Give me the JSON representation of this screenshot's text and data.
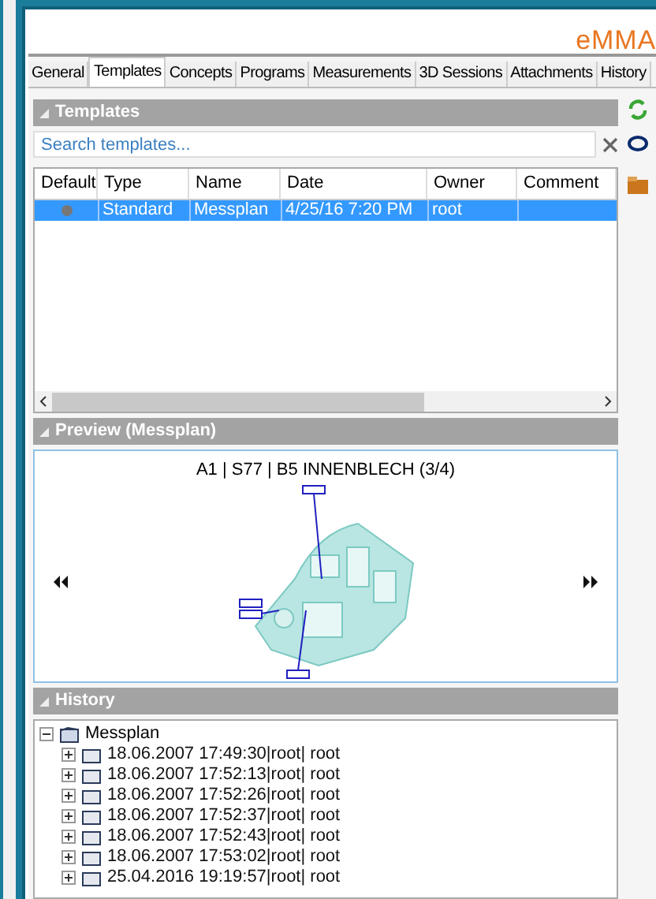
{
  "logo": "eMMA",
  "tabs": [
    {
      "label": "General",
      "selected": false
    },
    {
      "label": "Templates",
      "selected": true
    },
    {
      "label": "Concepts",
      "selected": false
    },
    {
      "label": "Programs",
      "selected": false
    },
    {
      "label": "Measurements",
      "selected": false
    },
    {
      "label": "3D Sessions",
      "selected": false
    },
    {
      "label": "Attachments",
      "selected": false
    },
    {
      "label": "History",
      "selected": false
    }
  ],
  "templates": {
    "title": "Templates",
    "search": {
      "placeholder": "Search templates..."
    },
    "columns": [
      "Default",
      "Type",
      "Name",
      "Date",
      "Owner",
      "Comment"
    ],
    "rows": [
      {
        "default": true,
        "selected": true,
        "cells": [
          "",
          "Standard",
          "Messplan",
          "4/25/16 7:20 PM",
          "root",
          ""
        ]
      }
    ]
  },
  "preview": {
    "title": "Preview (Messplan)",
    "caption": "A1 | S77 | B5 INNENBLECH (3/4)"
  },
  "history": {
    "title": "History",
    "tree": [
      {
        "label": "Messplan",
        "expanded": true,
        "children": [
          {
            "label": "18.06.2007 17:49:30|root| root",
            "expanded": false
          },
          {
            "label": "18.06.2007 17:52:13|root| root",
            "expanded": false
          },
          {
            "label": "18.06.2007 17:52:26|root| root",
            "expanded": false
          },
          {
            "label": "18.06.2007 17:52:37|root| root",
            "expanded": false
          },
          {
            "label": "18.06.2007 17:52:43|root| root",
            "expanded": false
          },
          {
            "label": "18.06.2007 17:53:02|root| root",
            "expanded": false
          },
          {
            "label": "25.04.2016 19:19:57|root| root",
            "expanded": false
          }
        ]
      }
    ]
  }
}
